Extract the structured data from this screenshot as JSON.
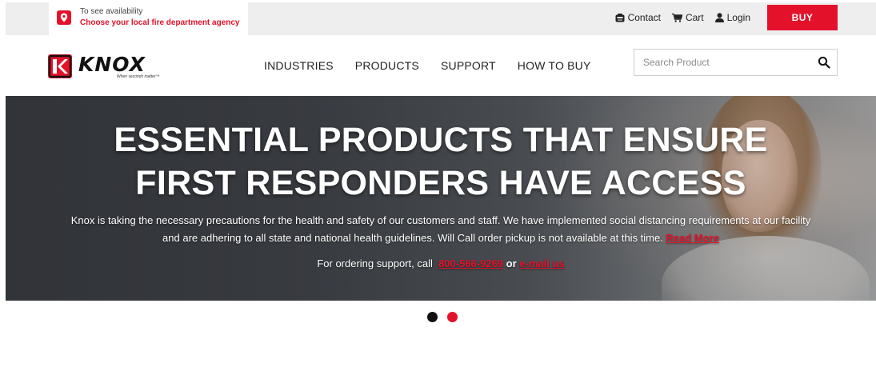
{
  "topbar": {
    "agency": {
      "line1": "To see availability",
      "line2": "Choose your local fire department agency",
      "icon": "map-pin-icon"
    },
    "links": [
      {
        "label": "Contact",
        "icon": "contact-icon"
      },
      {
        "label": "Cart",
        "icon": "cart-icon"
      },
      {
        "label": "Login",
        "icon": "user-icon"
      }
    ],
    "buy_label": "BUY"
  },
  "header": {
    "logo": {
      "word": "KNOX",
      "tagline": "When seconds matter™"
    },
    "nav": [
      "INDUSTRIES",
      "PRODUCTS",
      "SUPPORT",
      "HOW TO BUY"
    ],
    "search": {
      "placeholder": "Search Product",
      "value": "",
      "icon": "search-icon"
    }
  },
  "hero": {
    "title_line1": "ESSENTIAL PRODUCTS THAT ENSURE",
    "title_line2": "FIRST RESPONDERS HAVE ACCESS",
    "body_text": "Knox is taking the necessary precautions for the health and safety of our customers and staff. We have implemented social distancing requirements at our facility and are adhering to all state and national health guidelines. Will Call order pickup is not available at this time.",
    "read_more": "Read More",
    "support_prefix": "For ordering support, call",
    "phone": "800-566-9269",
    "or": "or",
    "email_link": "e-mail us"
  },
  "carousel": {
    "slides": 2,
    "active_index": 0
  },
  "colors": {
    "brand_red": "#e3122a",
    "topbar_bg": "#eeeeee"
  }
}
